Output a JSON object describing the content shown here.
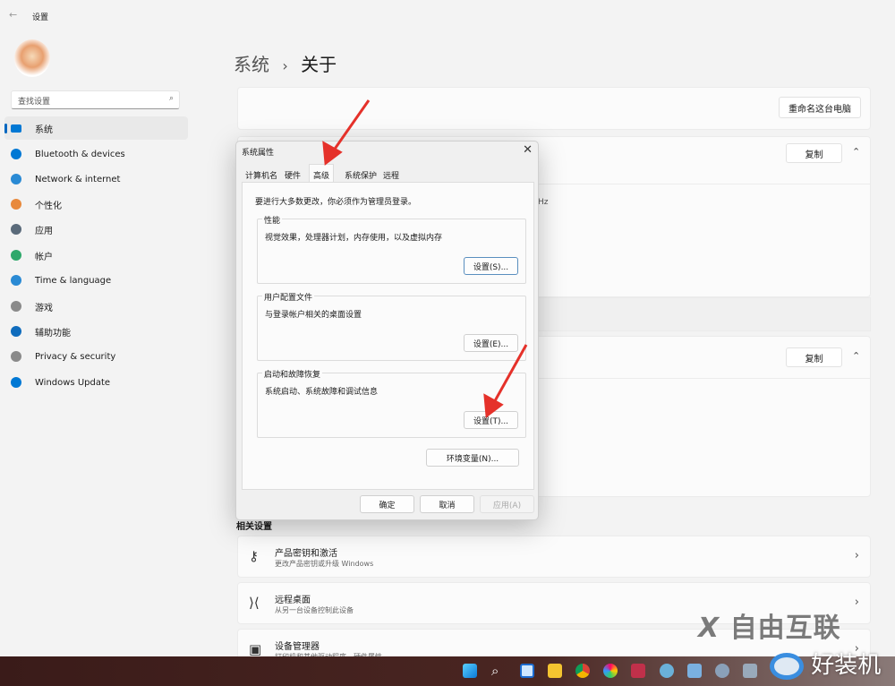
{
  "window": {
    "title": "设置"
  },
  "sidebar": {
    "search_placeholder": "查找设置",
    "items": [
      {
        "label": "系统",
        "icon": "system-icon",
        "color": "#0078d4"
      },
      {
        "label": "Bluetooth & devices",
        "icon": "bluetooth-icon",
        "color": "#0078d4"
      },
      {
        "label": "Network & internet",
        "icon": "wifi-icon",
        "color": "#2a8ad4"
      },
      {
        "label": "个性化",
        "icon": "brush-icon",
        "color": "#e8893c"
      },
      {
        "label": "应用",
        "icon": "apps-icon",
        "color": "#5a6a7a"
      },
      {
        "label": "帐户",
        "icon": "account-icon",
        "color": "#2fa86b"
      },
      {
        "label": "Time & language",
        "icon": "globe-clock-icon",
        "color": "#2a8ad4"
      },
      {
        "label": "游戏",
        "icon": "gamepad-icon",
        "color": "#8a8a8a"
      },
      {
        "label": "辅助功能",
        "icon": "accessibility-icon",
        "color": "#0f6cbd"
      },
      {
        "label": "Privacy & security",
        "icon": "shield-icon",
        "color": "#8a8a8a"
      },
      {
        "label": "Windows Update",
        "icon": "update-icon",
        "color": "#0078d4"
      }
    ]
  },
  "main": {
    "breadcrumb": {
      "parent": "系统",
      "separator": "›",
      "current": "关于"
    },
    "rename_button": "重命名这台电脑",
    "copy_button": "复制",
    "hz_fragment": "Hz",
    "related_heading": "相关设置",
    "related": [
      {
        "title": "产品密钥和激活",
        "subtitle": "更改产品密钥或升级 Windows",
        "icon": "key-icon"
      },
      {
        "title": "远程桌面",
        "subtitle": "从另一台设备控制此设备",
        "icon": "remote-desktop-icon"
      },
      {
        "title": "设备管理器",
        "subtitle": "打印机和其他驱动程序、硬件属性",
        "icon": "device-manager-icon"
      }
    ]
  },
  "dialog": {
    "title": "系统属性",
    "tabs": [
      "计算机名",
      "硬件",
      "高级",
      "系统保护",
      "远程"
    ],
    "active_tab": "高级",
    "admin_note": "要进行大多数更改，你必须作为管理员登录。",
    "groups": [
      {
        "label": "性能",
        "desc": "视觉效果，处理器计划，内存使用，以及虚拟内存",
        "button": "设置(S)..."
      },
      {
        "label": "用户配置文件",
        "desc": "与登录帐户相关的桌面设置",
        "button": "设置(E)..."
      },
      {
        "label": "启动和故障恢复",
        "desc": "系统启动、系统故障和调试信息",
        "button": "设置(T)..."
      }
    ],
    "env_button": "环境变量(N)...",
    "ok": "确定",
    "cancel": "取消",
    "apply": "应用(A)"
  },
  "watermarks": {
    "top": "自由互联",
    "bottom": "好装机"
  },
  "colors": {
    "accent": "#0067c0",
    "arrow": "#e5312a",
    "taskbar": "#3a1b19"
  }
}
